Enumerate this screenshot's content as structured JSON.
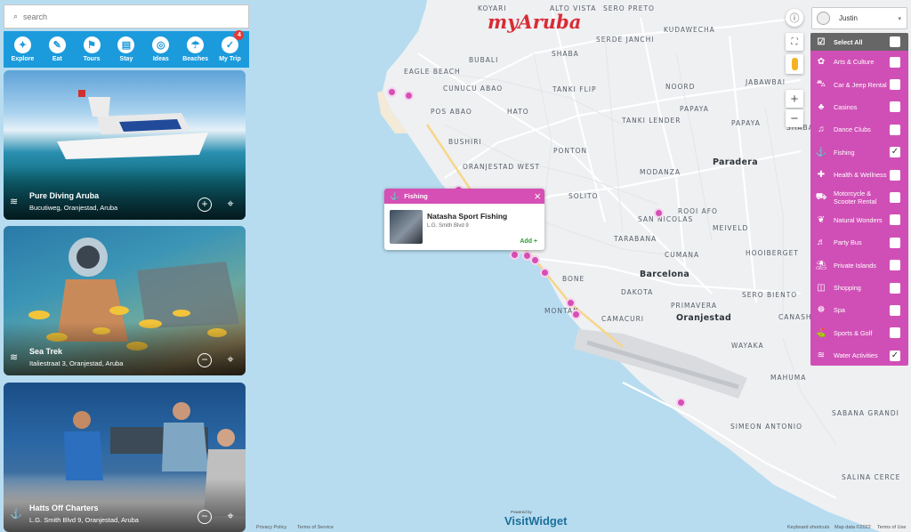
{
  "search": {
    "placeholder": "search"
  },
  "nav": [
    {
      "label": "Explore",
      "icon": "explore-icon",
      "glyph": "✦"
    },
    {
      "label": "Eat",
      "icon": "eat-icon",
      "glyph": "✎"
    },
    {
      "label": "Tours",
      "icon": "tours-icon",
      "glyph": "⚑"
    },
    {
      "label": "Stay",
      "icon": "stay-icon",
      "glyph": "▤"
    },
    {
      "label": "Ideas",
      "icon": "ideas-icon",
      "glyph": "◎"
    },
    {
      "label": "Beaches",
      "icon": "beaches-icon",
      "glyph": "☂"
    },
    {
      "label": "My Trip",
      "icon": "my-trip-icon",
      "glyph": "✓",
      "badge": "4"
    }
  ],
  "cards": [
    {
      "title": "Pure Diving Aruba",
      "address": "Bucutiweg, Oranjestad, Aruba",
      "action": "+",
      "category_icon": "water-activities-icon"
    },
    {
      "title": "Sea Trek",
      "address": "Italiestraat 3, Oranjestad, Aruba",
      "action": "−",
      "category_icon": "water-activities-icon"
    },
    {
      "title": "Hatts Off Charters",
      "address": "L.G. Smith Blvd 9, Oranjestad, Aruba",
      "action": "−",
      "category_icon": "fishing-icon"
    }
  ],
  "brand": {
    "logo": "myAruba",
    "color": "#d92b35"
  },
  "popup": {
    "category": "Fishing",
    "title": "Natasha Sport Fishing",
    "address": "L.G. Smith Blvd 9",
    "add_label": "Add +"
  },
  "user": {
    "name": "Justin"
  },
  "categories": {
    "select_all": "Select All",
    "items": [
      {
        "label": "Arts & Culture",
        "icon": "arts-culture-icon",
        "checked": false
      },
      {
        "label": "Car & Jeep Rental",
        "icon": "car-rental-icon",
        "checked": false
      },
      {
        "label": "Casinos",
        "icon": "casino-icon",
        "checked": false
      },
      {
        "label": "Dance Clubs",
        "icon": "dance-club-icon",
        "checked": false
      },
      {
        "label": "Fishing",
        "icon": "fishing-icon",
        "checked": true
      },
      {
        "label": "Health & Wellness",
        "icon": "health-icon",
        "checked": false
      },
      {
        "label": "Motorcycle & Scooter Rental",
        "icon": "motorcycle-icon",
        "checked": false
      },
      {
        "label": "Natural Wonders",
        "icon": "nature-icon",
        "checked": false
      },
      {
        "label": "Party Bus",
        "icon": "party-bus-icon",
        "checked": false
      },
      {
        "label": "Private Islands",
        "icon": "island-icon",
        "checked": false
      },
      {
        "label": "Shopping",
        "icon": "shopping-icon",
        "checked": false
      },
      {
        "label": "Spa",
        "icon": "spa-icon",
        "checked": false
      },
      {
        "label": "Sports & Golf",
        "icon": "golf-icon",
        "checked": false
      },
      {
        "label": "Water Activities",
        "icon": "water-activities-icon",
        "checked": true
      }
    ]
  },
  "map_labels": [
    "KOYARI",
    "ALTO VISTA",
    "SERO PRETO",
    "KUDAWECHA",
    "NOORD",
    "SERDE JANCHI",
    "SHABA",
    "BUBALI",
    "EAGLE BEACH",
    "CUNUCU ABAO",
    "TANKI FLIP",
    "NOORD",
    "JABAWBAI",
    "NOORD",
    "POS ABAO",
    "HATO",
    "TANKI LENDER",
    "PAPAYA",
    "PAPAYA",
    "SHABA",
    "BUSHIRI",
    "PONTON",
    "Paradera",
    "ORANJESTAD WEST",
    "MODANZA",
    "SOLITO",
    "ROOI AFO",
    "SAN NICOLAS",
    "MEIVELD",
    "TARABANA",
    "CUMANA",
    "HOOIBERGET",
    "Barcelona",
    "BONE",
    "DAKOTA",
    "SERO BIENTO",
    "PRIMAVERA",
    "MONTAN",
    "Oranjestad",
    "CAMACURI",
    "WAYAKA",
    "CANASHITO",
    "MAHUMA",
    "SABANA GRANDI",
    "SIMEON ANTONIO",
    "SALINA CERCE"
  ],
  "footer": {
    "privacy": "Privacy Policy",
    "terms": "Terms of Service",
    "powered": "Powered by",
    "widget": "VisitWidget",
    "keyboard": "Keyboard shortcuts",
    "mapdata": "Map data ©2022",
    "terms_use": "Terms of Use"
  }
}
